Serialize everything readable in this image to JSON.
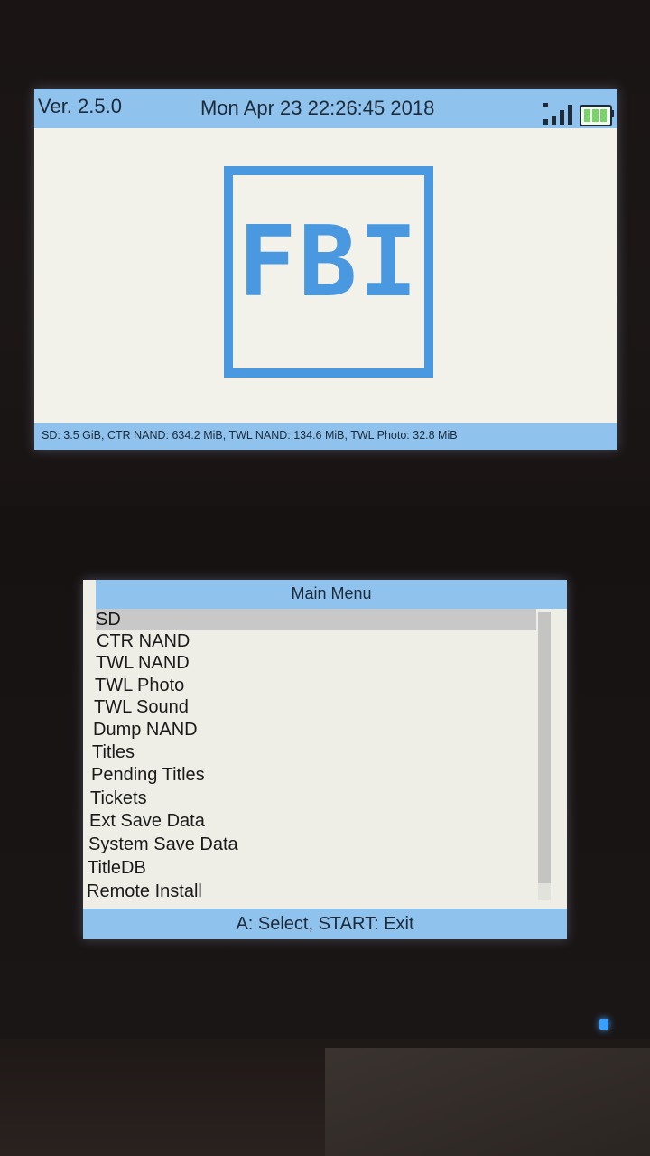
{
  "top_screen": {
    "version": "Ver. 2.5.0",
    "datetime": "Mon Apr 23 22:26:45 2018",
    "logo_text": "FBI",
    "storage_info": "SD: 3.5 GiB, CTR NAND: 634.2 MiB, TWL NAND: 134.6 MiB, TWL Photo: 32.8 MiB",
    "signal_icon": "wifi-signal-icon",
    "battery_icon": "battery-icon"
  },
  "bottom_screen": {
    "title": "Main Menu",
    "selected_index": 0,
    "items": [
      {
        "label": "SD"
      },
      {
        "label": "CTR NAND"
      },
      {
        "label": "TWL NAND"
      },
      {
        "label": "TWL Photo"
      },
      {
        "label": "TWL Sound"
      },
      {
        "label": "Dump NAND"
      },
      {
        "label": "Titles"
      },
      {
        "label": "Pending Titles"
      },
      {
        "label": "Tickets"
      },
      {
        "label": "Ext Save Data"
      },
      {
        "label": "System Save Data"
      },
      {
        "label": "TitleDB"
      },
      {
        "label": "Remote Install"
      }
    ],
    "hint": "A: Select, START: Exit"
  },
  "colors": {
    "accent": "#8fc2ec",
    "logo": "#4a98e0",
    "screen_bg": "#f2f1ea"
  }
}
